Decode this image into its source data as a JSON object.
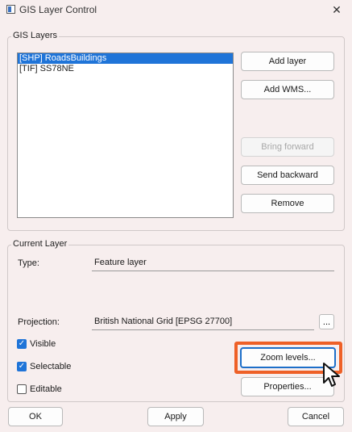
{
  "window": {
    "title": "GIS Layer Control",
    "close_label": "✕"
  },
  "layers_group": {
    "title": "GIS Layers",
    "layers": [
      {
        "label": "[SHP] RoadsBuildings",
        "selected": true
      },
      {
        "label": "[TIF] SS78NE",
        "selected": false
      }
    ],
    "buttons": {
      "add_layer": "Add layer",
      "add_wms": "Add WMS...",
      "bring_forward": "Bring forward",
      "send_backward": "Send backward",
      "remove": "Remove"
    }
  },
  "current_layer": {
    "title": "Current Layer",
    "type_label": "Type:",
    "type_value": "Feature layer",
    "projection_label": "Projection:",
    "projection_value": "British National Grid [EPSG 27700]",
    "projection_button": "...",
    "checkboxes": {
      "visible": {
        "label": "Visible",
        "checked": true
      },
      "selectable": {
        "label": "Selectable",
        "checked": true
      },
      "editable": {
        "label": "Editable",
        "checked": false
      }
    },
    "zoom_levels_button": "Zoom levels...",
    "properties_button": "Properties..."
  },
  "footer": {
    "ok": "OK",
    "apply": "Apply",
    "cancel": "Cancel"
  },
  "colors": {
    "highlight": "#ee6027",
    "selection": "#1f74d8"
  }
}
